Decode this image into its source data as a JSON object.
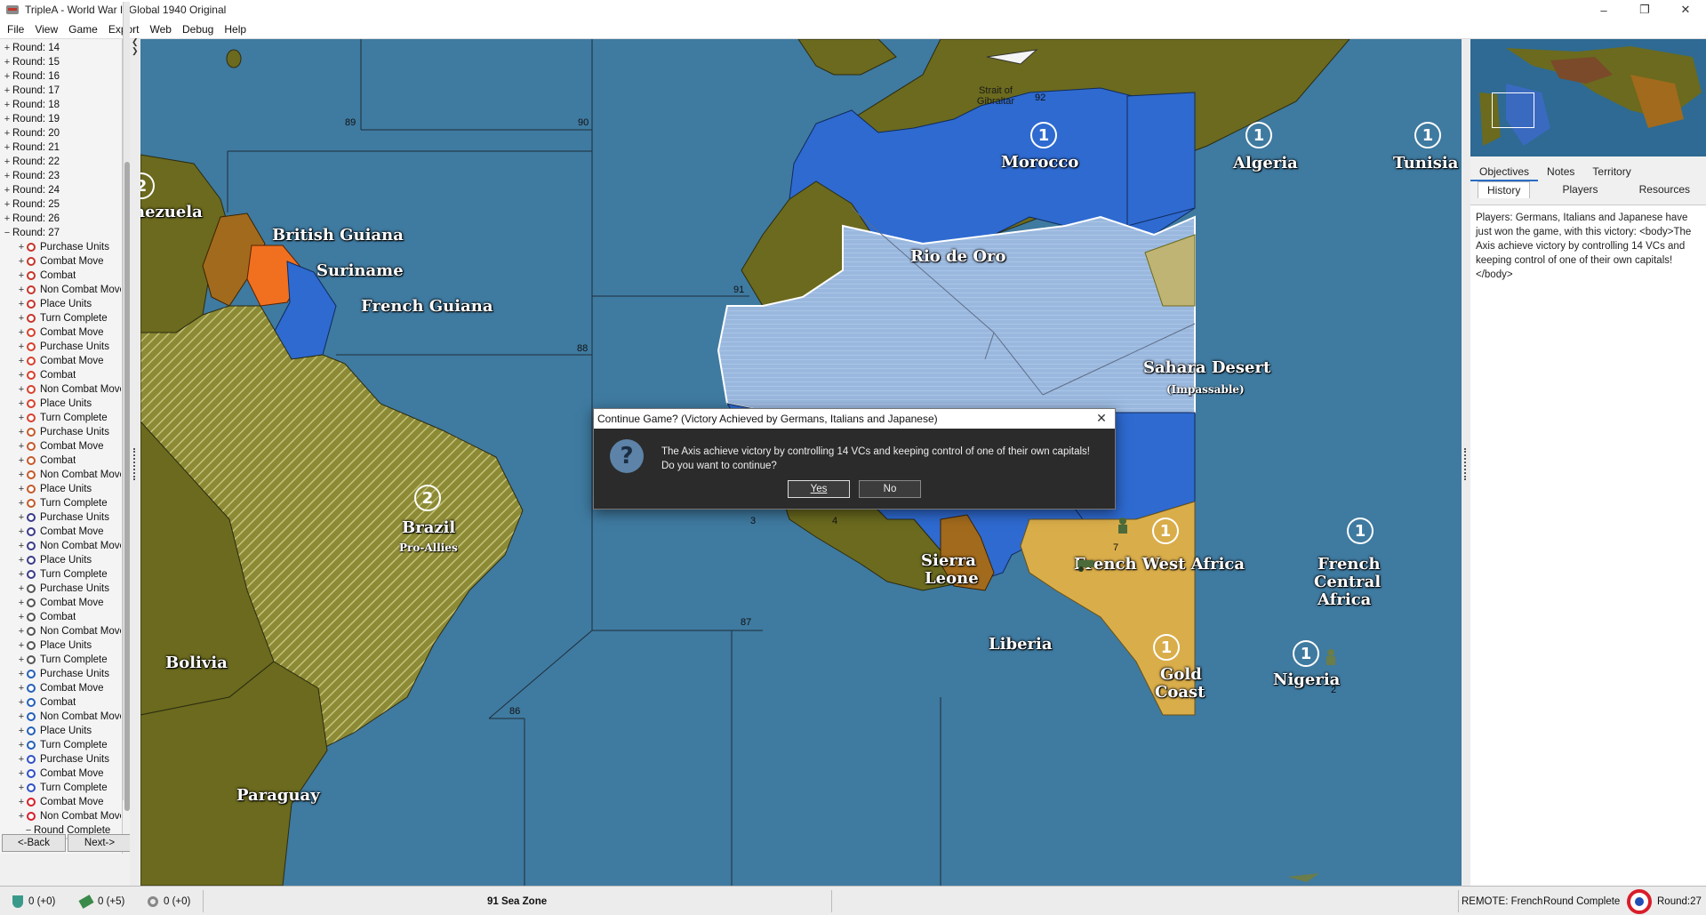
{
  "window": {
    "title": "TripleA - World War II Global 1940 Original",
    "minimize": "–",
    "maximize": "❐",
    "close": "✕"
  },
  "menu": [
    "File",
    "View",
    "Game",
    "Export",
    "Web",
    "Debug",
    "Help"
  ],
  "history_tree": {
    "rounds": [
      "Round: 14",
      "Round: 15",
      "Round: 16",
      "Round: 17",
      "Round: 18",
      "Round: 19",
      "Round: 20",
      "Round: 21",
      "Round: 22",
      "Round: 23",
      "Round: 24",
      "Round: 25",
      "Round: 26",
      "Round: 27"
    ],
    "round27_steps": [
      {
        "label": "Purchase Units",
        "icon": "#c7342a"
      },
      {
        "label": "Combat Move",
        "icon": "#c7342a"
      },
      {
        "label": "Combat",
        "icon": "#c7342a"
      },
      {
        "label": "Non Combat Move",
        "icon": "#c7342a"
      },
      {
        "label": "Place Units",
        "icon": "#c7342a"
      },
      {
        "label": "Turn Complete",
        "icon": "#c7342a"
      },
      {
        "label": "Combat Move",
        "icon": "#d8402c"
      },
      {
        "label": "Purchase Units",
        "icon": "#d8402c"
      },
      {
        "label": "Combat Move",
        "icon": "#d8402c"
      },
      {
        "label": "Combat",
        "icon": "#d8402c"
      },
      {
        "label": "Non Combat Move",
        "icon": "#d8402c"
      },
      {
        "label": "Place Units",
        "icon": "#d8402c"
      },
      {
        "label": "Turn Complete",
        "icon": "#d8402c"
      },
      {
        "label": "Purchase Units",
        "icon": "#c45a2a"
      },
      {
        "label": "Combat Move",
        "icon": "#c45a2a"
      },
      {
        "label": "Combat",
        "icon": "#c45a2a"
      },
      {
        "label": "Non Combat Move",
        "icon": "#c45a2a"
      },
      {
        "label": "Place Units",
        "icon": "#c45a2a"
      },
      {
        "label": "Turn Complete",
        "icon": "#c45a2a"
      },
      {
        "label": "Purchase Units",
        "icon": "#3a3a8a"
      },
      {
        "label": "Combat Move",
        "icon": "#3a3a8a"
      },
      {
        "label": "Non Combat Move",
        "icon": "#3a3a8a"
      },
      {
        "label": "Place Units",
        "icon": "#3a3a8a"
      },
      {
        "label": "Turn Complete",
        "icon": "#3a3a8a"
      },
      {
        "label": "Purchase Units",
        "icon": "#555555"
      },
      {
        "label": "Combat Move",
        "icon": "#555555"
      },
      {
        "label": "Combat",
        "icon": "#555555"
      },
      {
        "label": "Non Combat Move",
        "icon": "#555555"
      },
      {
        "label": "Place Units",
        "icon": "#555555"
      },
      {
        "label": "Turn Complete",
        "icon": "#555555"
      },
      {
        "label": "Purchase Units",
        "icon": "#2460b8"
      },
      {
        "label": "Combat Move",
        "icon": "#2460b8"
      },
      {
        "label": "Combat",
        "icon": "#2460b8"
      },
      {
        "label": "Non Combat Move",
        "icon": "#2460b8"
      },
      {
        "label": "Place Units",
        "icon": "#2460b8"
      },
      {
        "label": "Turn Complete",
        "icon": "#2460b8"
      },
      {
        "label": "Purchase Units",
        "icon": "#3050c8"
      },
      {
        "label": "Combat Move",
        "icon": "#3050c8"
      },
      {
        "label": "Turn Complete",
        "icon": "#3050c8"
      },
      {
        "label": "Combat Move",
        "icon": "#d81e2a"
      },
      {
        "label": "Non Combat Move",
        "icon": "#d81e2a"
      }
    ],
    "round_complete": "Round Complete",
    "selected_leaf": "Players: Germans, Italians and Japanese have just won the game"
  },
  "nav": {
    "back": "<-Back",
    "next": "Next->"
  },
  "map": {
    "sea_zones": [
      "89",
      "90",
      "92",
      "91",
      "88",
      "87",
      "86",
      "3",
      "4"
    ],
    "territories": {
      "venezuela": "nezuela",
      "british_guiana": "British Guiana",
      "suriname": "Suriname",
      "french_guiana": "French Guiana",
      "brazil": "Brazil",
      "brazil_sub": "Pro-Allies",
      "bolivia": "Bolivia",
      "paraguay": "Paraguay",
      "morocco": "Morocco",
      "algeria": "Algeria",
      "tunisia": "Tunisia",
      "rio_de_oro": "Rio de Oro",
      "sahara": "Sahara Desert",
      "sahara_sub": "(Impassable)",
      "sierra_leone_1": "Sierra",
      "sierra_leone_2": "Leone",
      "liberia": "Liberia",
      "french_west_africa": "French West Africa",
      "french_central_africa_1": "French",
      "french_central_africa_2": "Central",
      "french_central_africa_3": "Africa",
      "gold_coast_1": "Gold",
      "gold_coast_2": "Coast",
      "nigeria": "Nigeria",
      "strait": "Strait of\nGibraltar"
    },
    "production": {
      "venezuela": "2",
      "brazil": "2",
      "morocco": "1",
      "algeria": "1",
      "tunisia": "1",
      "french_west_africa": "1",
      "french_central_africa": "1",
      "gold_coast": "1",
      "nigeria": "1"
    },
    "unit_counts": {
      "fwa": "7",
      "nigeria": "2"
    },
    "colors": {
      "sea": "#3f7aa0",
      "axis_olive": "#6b6a1e",
      "french_blue": "#2e6ad0",
      "sahara": "#9cb9de",
      "orange": "#f07020",
      "brown": "#a26a1c",
      "uk_gold": "#d9ad4a"
    }
  },
  "dialog": {
    "title": "Continue Game?  (Victory Achieved by Germans, Italians and Japanese)",
    "line1": "The Axis achieve victory by controlling 14 VCs and keeping control of one of their own capitals!",
    "line2": "Do you want to continue?",
    "yes": "Yes",
    "no": "No",
    "close": "✕",
    "icon": "?"
  },
  "right_panel": {
    "tabs_row1": [
      "Objectives",
      "Notes",
      "Territory"
    ],
    "tabs_row2": [
      "History",
      "Players",
      "Resources"
    ],
    "active_row1": "Objectives",
    "active_row2": "History",
    "history_text": "Players: Germans, Italians and Japanese have just won the game, with this victory: <body>The Axis achieve victory by controlling 14 VCs and keeping control of one of their own capitals!</body>"
  },
  "status": {
    "res1": "0 (+0)",
    "res2": "0 (+5)",
    "res3": "0 (+0)",
    "territory": "91 Sea Zone",
    "remote": "REMOTE: French",
    "phase": "Round Complete",
    "round": "Round:27"
  }
}
